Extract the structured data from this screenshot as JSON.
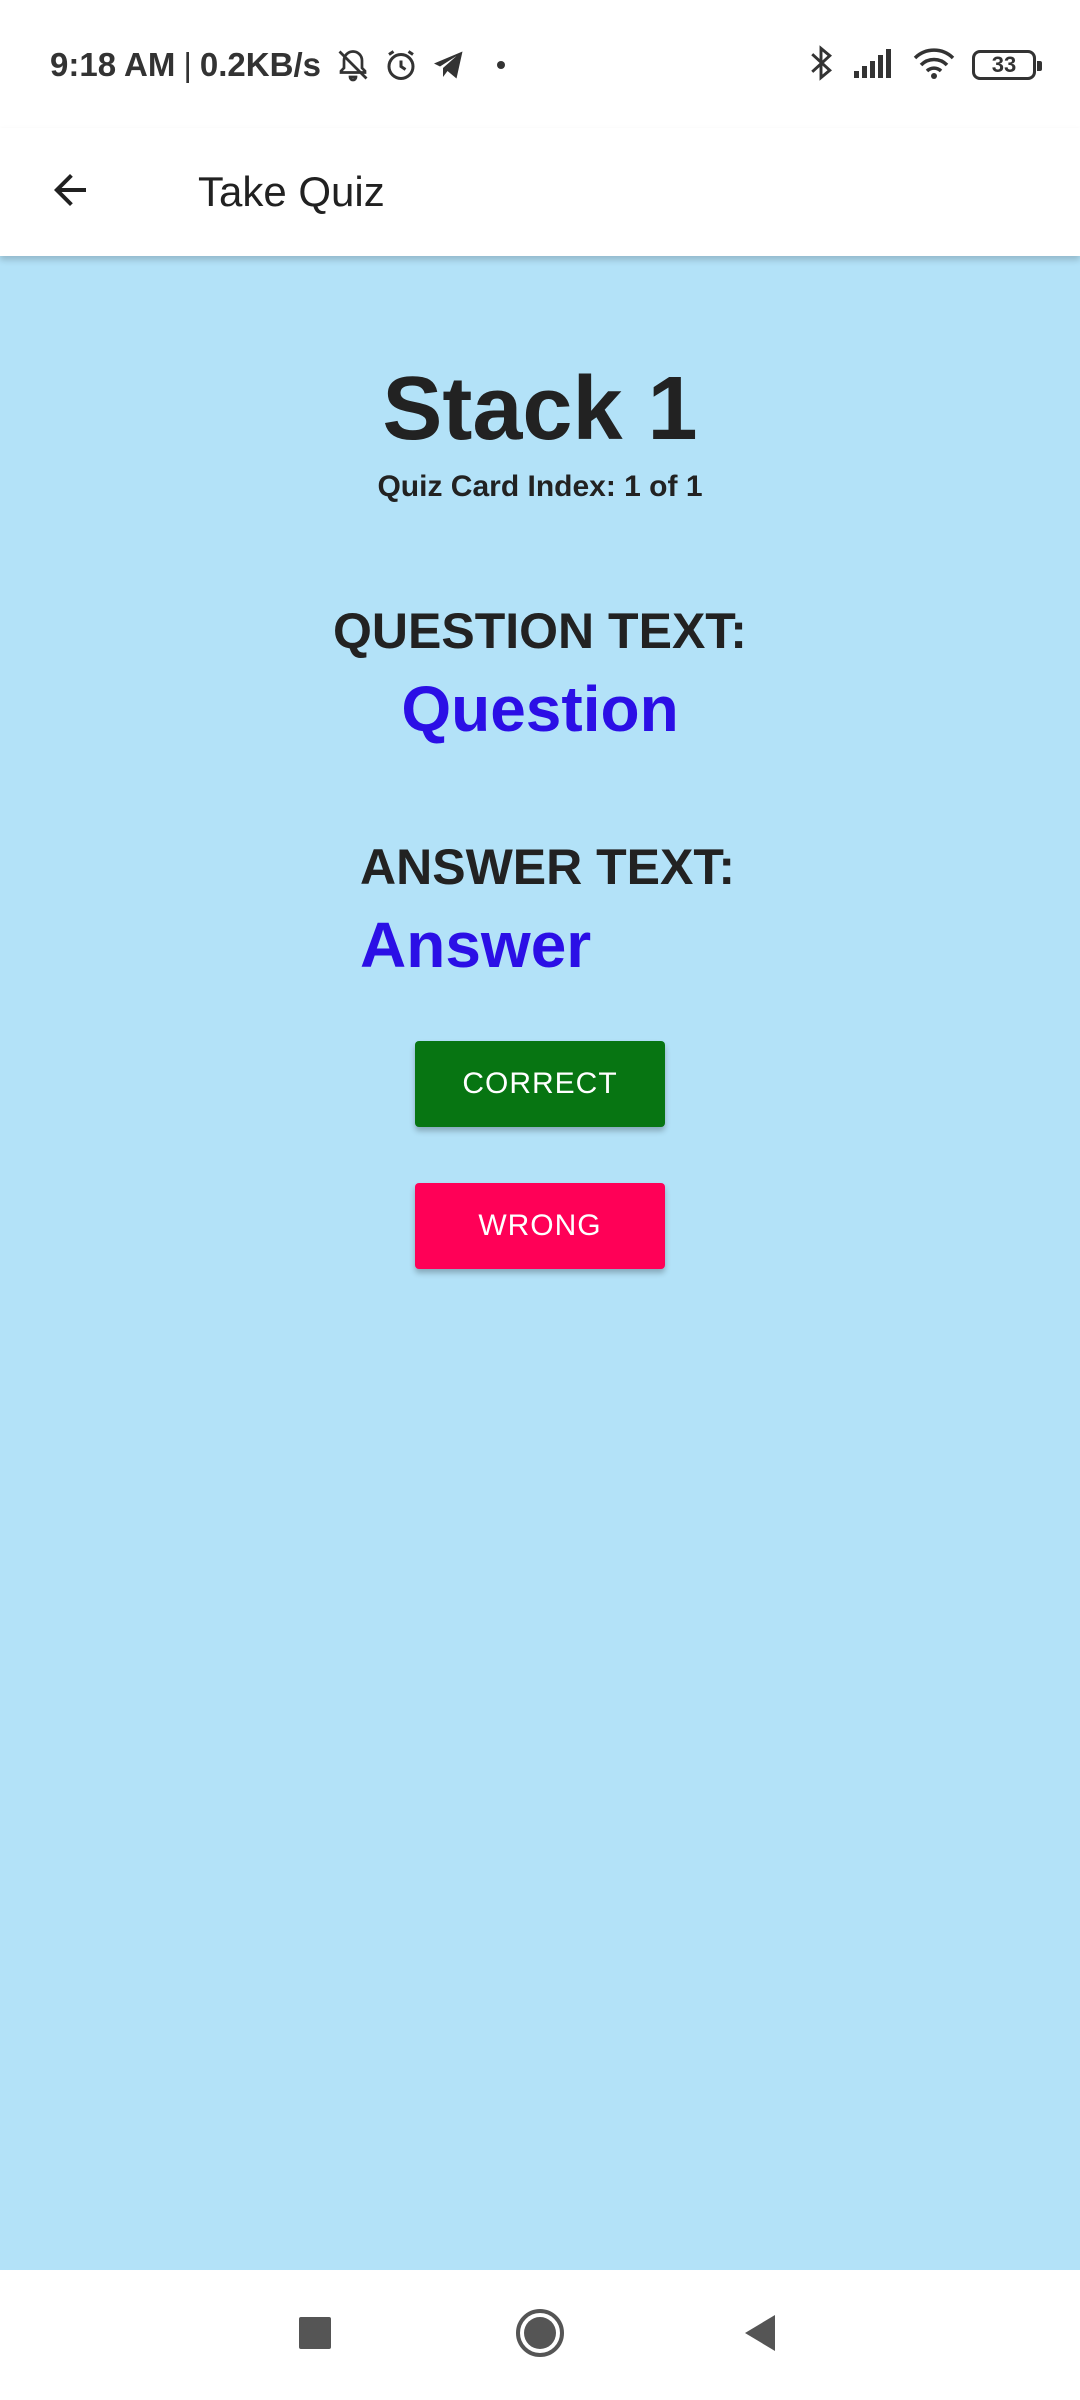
{
  "status_bar": {
    "time": "9:18 AM",
    "separator": "|",
    "net_speed": "0.2KB/s",
    "battery_level": "33",
    "icons": [
      "mute-icon",
      "alarm-icon",
      "telegram-icon",
      "bluetooth-icon",
      "signal-icon",
      "wifi-icon",
      "battery-icon"
    ]
  },
  "app_bar": {
    "title": "Take Quiz",
    "back_icon": "arrow-back-icon"
  },
  "quiz": {
    "stack_title": "Stack 1",
    "card_index": "Quiz Card Index: 1 of 1",
    "question_label": "QUESTION TEXT:",
    "question_text": "Question",
    "answer_label": "ANSWER TEXT:",
    "answer_text": "Answer",
    "correct_label": "CORRECT",
    "wrong_label": "WRONG"
  },
  "nav_bar": {
    "icons": [
      "recents-icon",
      "home-icon",
      "back-icon"
    ]
  },
  "colors": {
    "background": "#b3e2f8",
    "accent_text": "#2b0fe6",
    "correct_button": "#077512",
    "wrong_button": "#ff0057"
  }
}
